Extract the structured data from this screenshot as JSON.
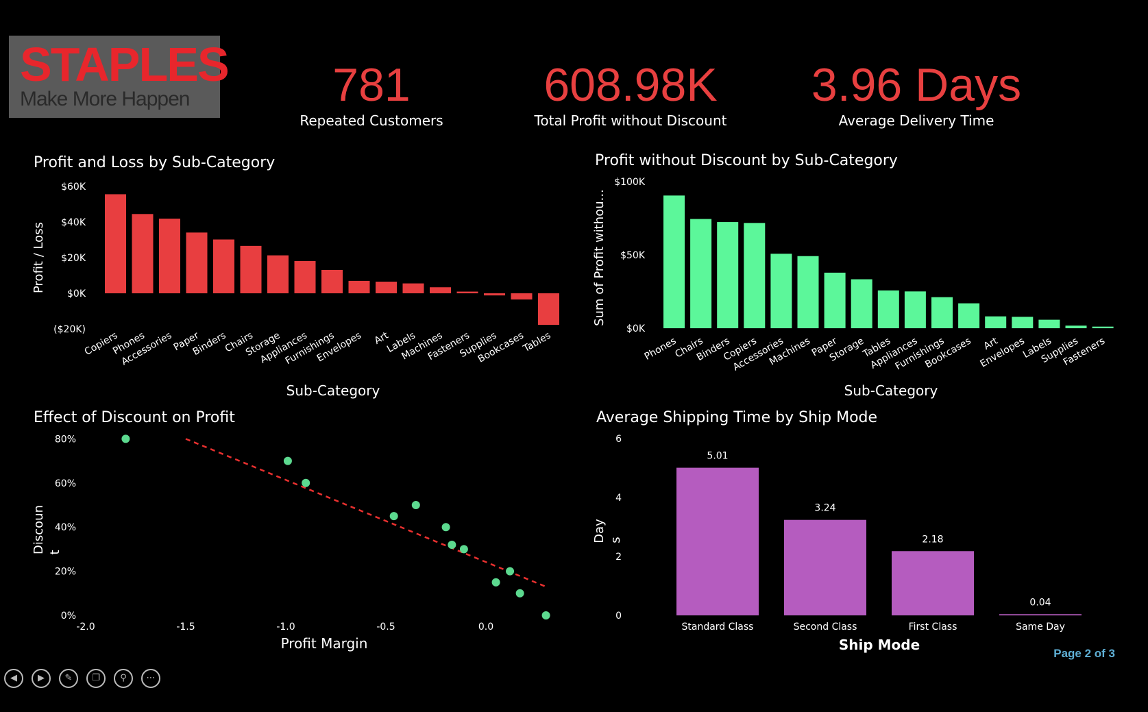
{
  "logo": {
    "brand": "STAPLES",
    "tagline": "Make More Happen"
  },
  "kpis": [
    {
      "value": "781",
      "label": "Repeated Customers"
    },
    {
      "value": "608.98K",
      "label": "Total Profit without Discount"
    },
    {
      "value": "3.96 Days",
      "label": "Average Delivery Time"
    }
  ],
  "page_indicator": "Page 2 of 3",
  "nav_icons": [
    "prev-icon",
    "next-icon",
    "pen-icon",
    "layers-icon",
    "zoom-icon",
    "more-icon"
  ],
  "colors": {
    "red": "#e83e40",
    "green": "#5cf79a",
    "purple": "#b55cbf",
    "scatter": "#5cd98f",
    "page": "#5fb0d6"
  },
  "chart_data": [
    {
      "type": "bar",
      "title": "Profit and Loss by Sub-Category",
      "xlabel": "Sub-Category",
      "ylabel": "Profit / Loss",
      "ylim": [
        -20000,
        60000
      ],
      "yticks": [
        "($20K)",
        "$0K",
        "$20K",
        "$40K",
        "$60K"
      ],
      "categories": [
        "Copiers",
        "Phones",
        "Accessories",
        "Paper",
        "Binders",
        "Chairs",
        "Storage",
        "Appliances",
        "Furnishings",
        "Envelopes",
        "Art",
        "Labels",
        "Machines",
        "Fasteners",
        "Supplies",
        "Bookcases",
        "Tables"
      ],
      "values": [
        55600,
        44500,
        41900,
        34100,
        30200,
        26600,
        21300,
        18100,
        13100,
        6960,
        6530,
        5550,
        3380,
        950,
        -1190,
        -3470,
        -17700
      ]
    },
    {
      "type": "bar",
      "title": "Profit without Discount by Sub-Category",
      "xlabel": "Sub-Category",
      "ylabel": "Sum of Profit withou...",
      "ylim": [
        0,
        100000
      ],
      "yticks": [
        "$0K",
        "$50K",
        "$100K"
      ],
      "categories": [
        "Phones",
        "Chairs",
        "Binders",
        "Copiers",
        "Accessories",
        "Machines",
        "Paper",
        "Storage",
        "Tables",
        "Appliances",
        "Furnishings",
        "Bookcases",
        "Art",
        "Envelopes",
        "Labels",
        "Supplies",
        "Fasteners"
      ],
      "values": [
        90500,
        74500,
        72400,
        71800,
        50800,
        49200,
        37900,
        33400,
        25800,
        25100,
        21200,
        17000,
        8100,
        7800,
        5800,
        1800,
        1100
      ]
    },
    {
      "type": "scatter",
      "title": "Effect of Discount on Profit",
      "xlabel": "Profit Margin",
      "ylabel": "Discount",
      "xlim": [
        -2.0,
        0.3
      ],
      "ylim": [
        0,
        0.8
      ],
      "xticks": [
        "-2.0",
        "-1.5",
        "-1.0",
        "-0.5",
        "0.0"
      ],
      "yticks": [
        "0%",
        "20%",
        "40%",
        "60%",
        "80%"
      ],
      "points": [
        {
          "x": -1.8,
          "y": 0.8
        },
        {
          "x": -0.99,
          "y": 0.7
        },
        {
          "x": -0.9,
          "y": 0.6
        },
        {
          "x": -0.46,
          "y": 0.45
        },
        {
          "x": -0.35,
          "y": 0.5
        },
        {
          "x": -0.2,
          "y": 0.4
        },
        {
          "x": -0.17,
          "y": 0.32
        },
        {
          "x": -0.11,
          "y": 0.3
        },
        {
          "x": 0.05,
          "y": 0.15
        },
        {
          "x": 0.12,
          "y": 0.2
        },
        {
          "x": 0.17,
          "y": 0.1
        },
        {
          "x": 0.3,
          "y": 0.0
        }
      ],
      "trendline": [
        {
          "x": -1.5,
          "y": 0.8
        },
        {
          "x": 0.3,
          "y": 0.13
        }
      ]
    },
    {
      "type": "bar",
      "title": "Average Shipping Time by Ship Mode",
      "xlabel": "Ship Mode",
      "ylabel": "Days",
      "ylim": [
        0,
        6
      ],
      "yticks": [
        "0",
        "2",
        "4",
        "6"
      ],
      "categories": [
        "Standard Class",
        "Second Class",
        "First Class",
        "Same Day"
      ],
      "values": [
        5.01,
        3.24,
        2.18,
        0.04
      ],
      "data_labels": [
        "5.01",
        "3.24",
        "2.18",
        "0.04"
      ]
    }
  ]
}
